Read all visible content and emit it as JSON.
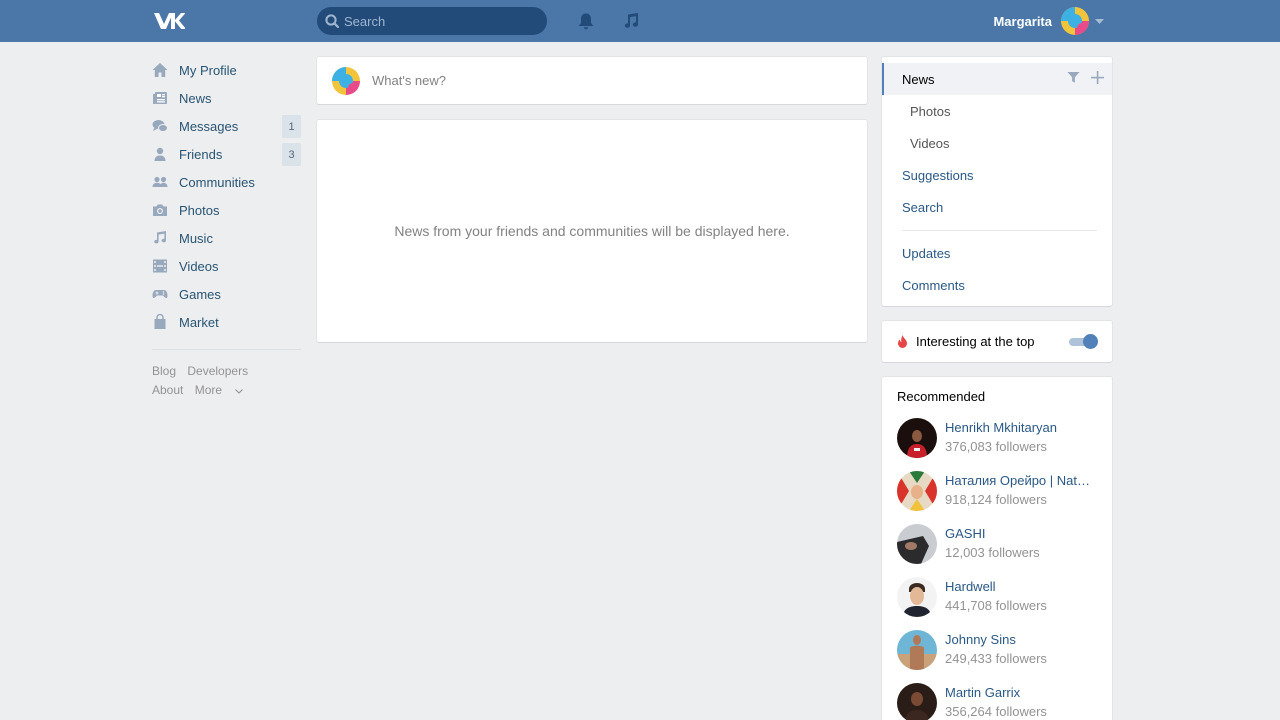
{
  "header": {
    "search_placeholder": "Search",
    "user_name": "Margarita",
    "colors": {
      "bar": "#4a76a8",
      "search_bg": "#224b7a"
    },
    "icons": [
      "vk-logo-icon",
      "search-icon",
      "bell-icon",
      "music-note-icon",
      "caret-down-icon"
    ]
  },
  "leftnav": {
    "items": [
      {
        "label": "My Profile",
        "icon": "home-icon"
      },
      {
        "label": "News",
        "icon": "newspaper-icon"
      },
      {
        "label": "Messages",
        "icon": "chat-bubbles-icon",
        "badge": "1"
      },
      {
        "label": "Friends",
        "icon": "person-icon",
        "badge": "3"
      },
      {
        "label": "Communities",
        "icon": "group-icon"
      },
      {
        "label": "Photos",
        "icon": "camera-icon"
      },
      {
        "label": "Music",
        "icon": "music-note-icon"
      },
      {
        "label": "Videos",
        "icon": "film-icon"
      },
      {
        "label": "Games",
        "icon": "gamepad-icon"
      },
      {
        "label": "Market",
        "icon": "shopping-bag-icon"
      }
    ],
    "footer": {
      "blog": "Blog",
      "developers": "Developers",
      "about": "About",
      "more": "More"
    }
  },
  "feed": {
    "post_placeholder": "What's new?",
    "empty_message": "News from your friends and communities will be displayed here."
  },
  "filters": {
    "items": [
      {
        "label": "News",
        "state": "active"
      },
      {
        "label": "Photos",
        "state": "sub"
      },
      {
        "label": "Videos",
        "state": "sub"
      },
      {
        "label": "Suggestions"
      },
      {
        "label": "Search"
      },
      {
        "label": "Updates"
      },
      {
        "label": "Comments"
      }
    ]
  },
  "interesting": {
    "label": "Interesting at the top",
    "enabled": true
  },
  "recommended": {
    "title": "Recommended",
    "items": [
      {
        "name": "Henrikh Mkhitaryan",
        "followers": "376,083 followers"
      },
      {
        "name": "Наталия Орейро | Natal...",
        "followers": "918,124 followers"
      },
      {
        "name": "GASHI",
        "followers": "12,003 followers"
      },
      {
        "name": "Hardwell",
        "followers": "441,708 followers"
      },
      {
        "name": "Johnny Sins",
        "followers": "249,433 followers"
      },
      {
        "name": "Martin Garrix",
        "followers": "356,264 followers"
      }
    ]
  }
}
